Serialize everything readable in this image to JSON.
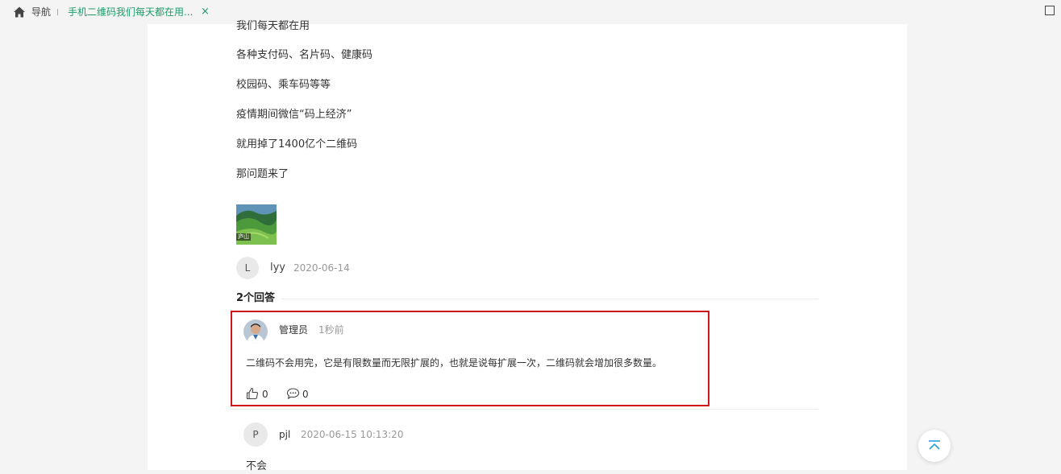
{
  "tabbar": {
    "home_label": "导航",
    "active_tab_title": "手机二维码我们每天都在用...",
    "close_symbol": "×"
  },
  "article": {
    "paragraphs": [
      "我们每天都在用",
      "各种支付码、名片码、健康码",
      "校园码、乘车码等等",
      "疫情期间微信“码上经济”",
      "就用掉了1400亿个二维码",
      "那问题来了"
    ],
    "image_caption": "庐山",
    "author": {
      "avatar_letter": "L",
      "name": "lyy",
      "date": "2020-06-14"
    }
  },
  "answers": {
    "title": "2个回答",
    "items": [
      {
        "name": "管理员",
        "time": "1秒前",
        "text": "二维码不会用完，它是有限数量而无限扩展的，也就是说每扩展一次，二维码就会增加很多数量。",
        "likes": "0",
        "comments": "0",
        "highlighted": true
      },
      {
        "avatar_letter": "P",
        "name": "pjl",
        "time": "2020-06-15 10:13:20",
        "text": "不会"
      }
    ]
  },
  "colors": {
    "accent_green": "#1a9e6a",
    "highlight_red": "#d0161a",
    "back_to_top_blue": "#2a9fe0"
  },
  "icons": [
    "home-icon",
    "close-icon",
    "window-maximize-icon",
    "thumbs-up-icon",
    "comment-icon",
    "back-to-top-icon"
  ]
}
